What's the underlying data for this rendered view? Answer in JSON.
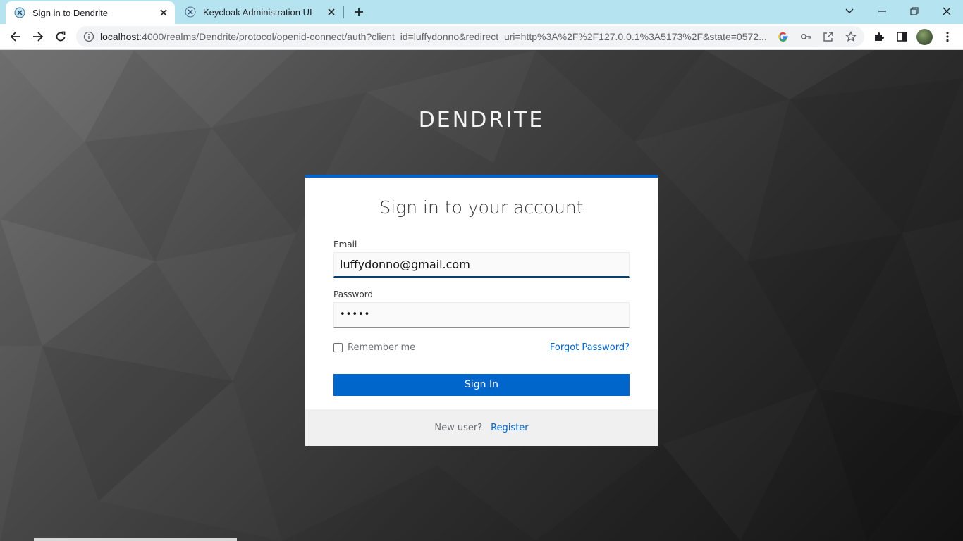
{
  "browser": {
    "tabs": [
      {
        "title": "Sign in to Dendrite",
        "active": true
      },
      {
        "title": "Keycloak Administration UI",
        "active": false
      }
    ],
    "url_host": "localhost",
    "url_rest": ":4000/realms/Dendrite/protocol/openid-connect/auth?client_id=luffydonno&redirect_uri=http%3A%2F%2F127.0.0.1%3A5173%2F&state=0572..."
  },
  "page": {
    "brand": "DENDRITE",
    "title": "Sign in to your account",
    "email_label": "Email",
    "email_value": "luffydonno@gmail.com",
    "password_label": "Password",
    "password_value": "•••••",
    "remember_label": "Remember me",
    "forgot_label": "Forgot Password?",
    "signin_label": "Sign In",
    "new_user_label": "New user?",
    "register_label": "Register"
  },
  "colors": {
    "tab_strip": "#b5e3f0",
    "primary": "#0066cc",
    "link": "#0066cc"
  }
}
